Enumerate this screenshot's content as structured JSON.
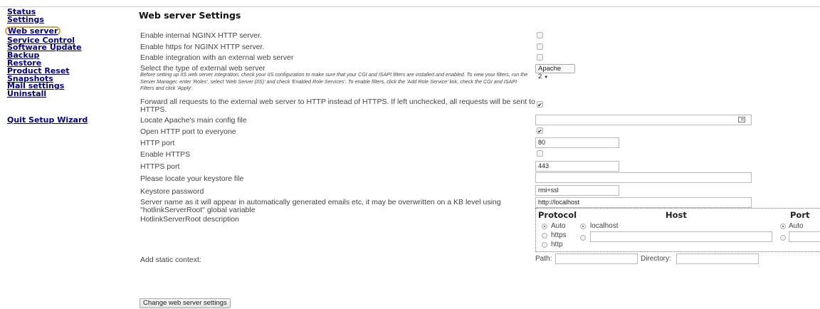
{
  "sidebar": {
    "items": [
      {
        "label": "Status"
      },
      {
        "label": "Settings"
      },
      {
        "label": "Web server"
      },
      {
        "label": "Service Control"
      },
      {
        "label": "Software Update"
      },
      {
        "label": "Backup"
      },
      {
        "label": "Restore"
      },
      {
        "label": "Product Reset"
      },
      {
        "label": "Snapshots"
      },
      {
        "label": "Mail settings"
      },
      {
        "label": "Uninstall"
      }
    ],
    "quit_label": "Quit Setup Wizard"
  },
  "page": {
    "title": "Web server Settings"
  },
  "form": {
    "enable_nginx": {
      "label": "Enable internal NGINX HTTP server.",
      "checked": false
    },
    "enable_https_nginx": {
      "label": "Enable https for NGINX HTTP server.",
      "checked": false
    },
    "enable_external": {
      "label": "Enable integration with an external web server",
      "checked": false
    },
    "external_type": {
      "label": "Select the type of external web server",
      "help": "Before setting up IIS web server integration, check your IIS configuration to make sure that your CGI and ISAPI filters are installed and enabled. To view your filters, run the Server Manager, enter 'Roles', select 'Web Server (IIS)' and check 'Enabled Role Services'. To enable filters, click the 'Add Role Service' link, check the CGI and ISAPI Filters and click 'Apply'.",
      "value": "Apache 2"
    },
    "forward_http": {
      "label": "Forward all requests to the external web server to HTTP instead of HTTPS. If left unchecked, all requests will be sent to HTTPS.",
      "checked": true,
      "mark": "✔"
    },
    "apache_config": {
      "label": "Locate Apache's main config file",
      "value": ""
    },
    "open_http_port": {
      "label": "Open HTTP port to everyone",
      "checked": true,
      "mark": "✔"
    },
    "http_port": {
      "label": "HTTP port",
      "value": "80"
    },
    "enable_https": {
      "label": "Enable HTTPS",
      "checked": false
    },
    "https_port": {
      "label": "HTTPS port",
      "value": "443"
    },
    "keystore_file": {
      "label": "Please locate your keystore file",
      "value": ""
    },
    "keystore_password": {
      "label": "Keystore password",
      "value": "rmi+ssl"
    },
    "server_name": {
      "label": "Server name as it will appear in automatically generated emails etc, it may be overwritten on a KB level using \"hotlinkServerRoot\" global variable",
      "value": "http://localhost"
    },
    "hotlink_desc": {
      "label": "HotlinkServerRoot description",
      "protocol_header": "Protocol",
      "host_header": "Host",
      "port_header": "Port",
      "protocol_options": [
        "Auto",
        "https",
        "http"
      ],
      "protocol_selected": "Auto",
      "host_option": "localhost",
      "port_option": "Auto"
    },
    "static_context": {
      "label": "Add static context:",
      "path_label": "Path:",
      "directory_label": "Directory:"
    },
    "submit_label": "Change web server settings"
  }
}
